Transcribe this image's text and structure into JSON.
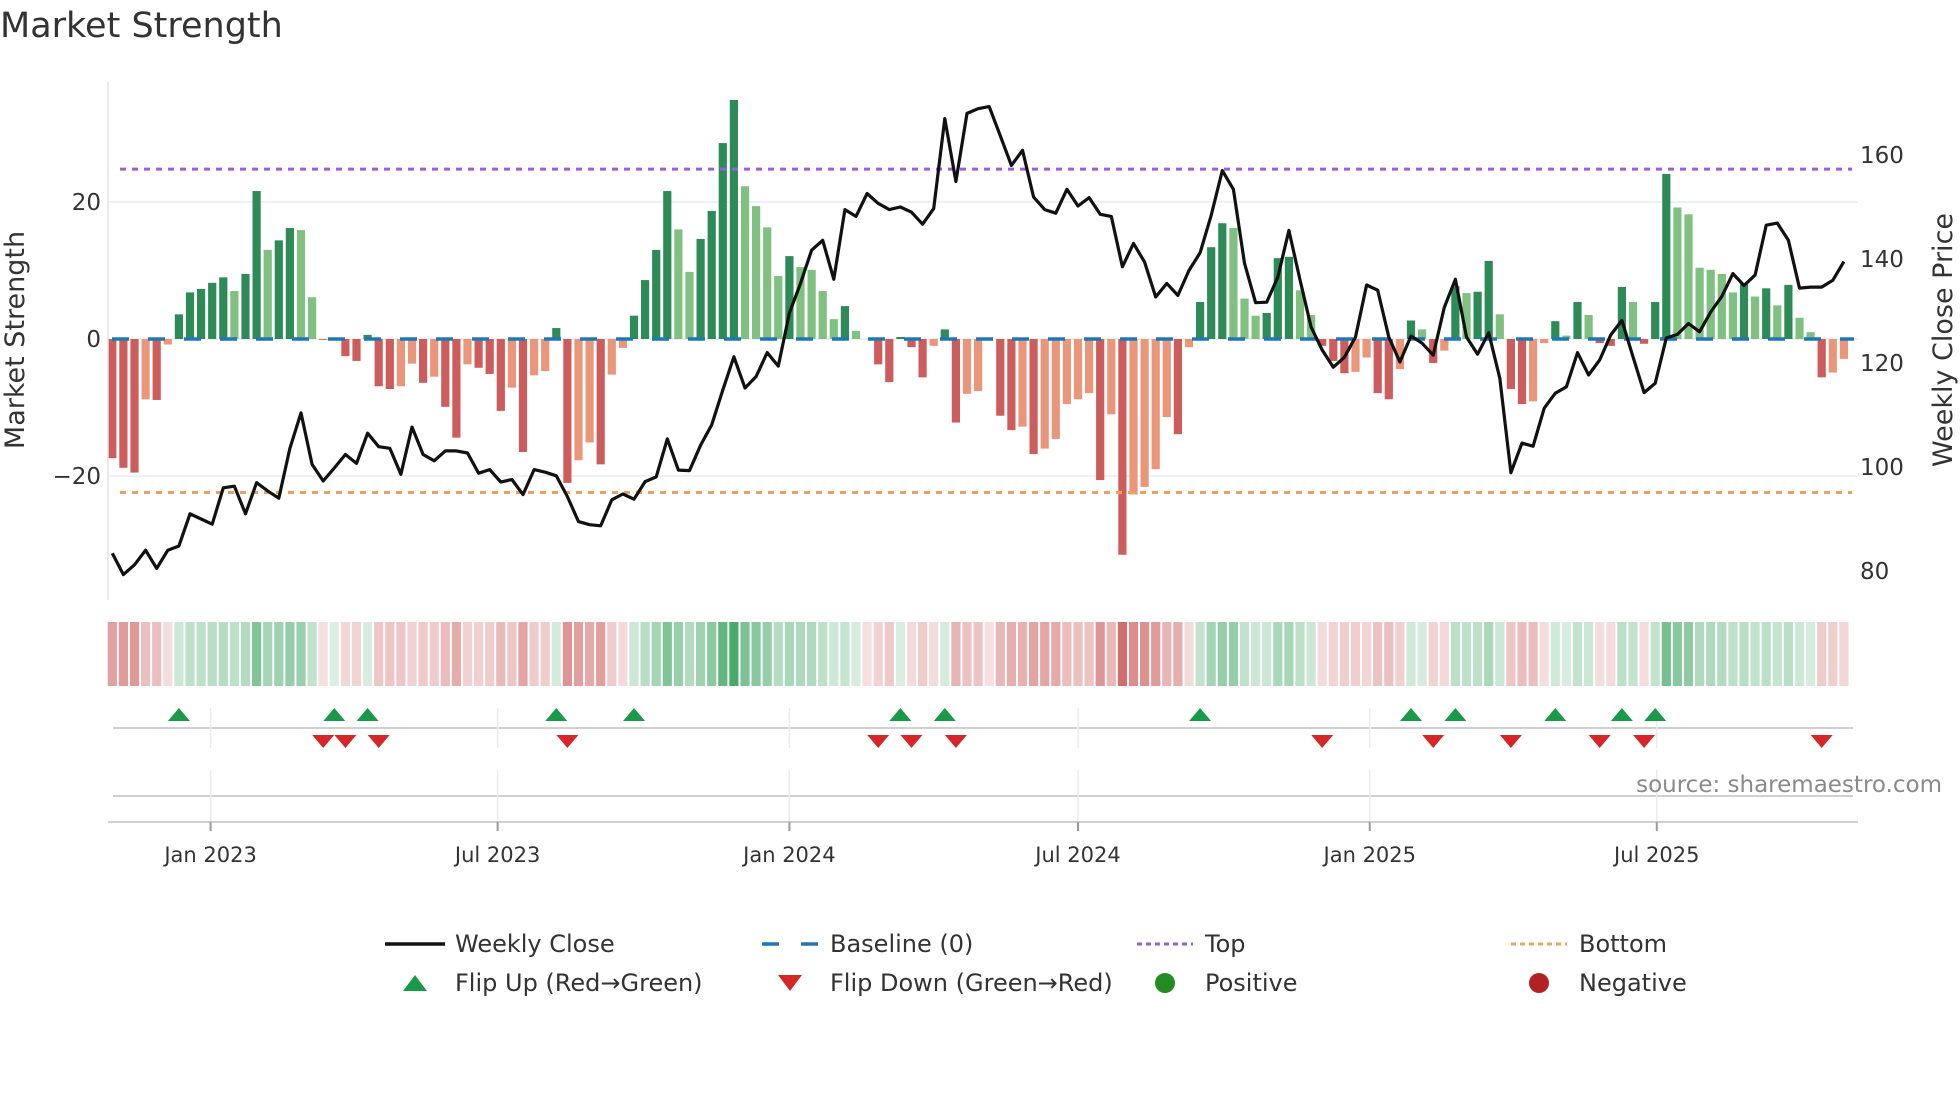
{
  "title": "Market Strength",
  "source": "source: sharemaestro.com",
  "colors": {
    "pos_dark": "#2e8b57",
    "pos_light": "#80c080",
    "neg_dark": "#cd5c5c",
    "neg_light": "#e9967a",
    "heat_pos": "#34a05a",
    "heat_neg": "#c85050",
    "line": "#111111",
    "baseline": "#1f77b4",
    "top": "#9b5fd9",
    "bottom": "#f0a060",
    "flip_up": "#1a9a48",
    "flip_down": "#d62728",
    "positive": "#228b22",
    "negative": "#b22222"
  },
  "chart_data": {
    "type": "bar",
    "title": "Market Strength",
    "ylabel": "Market Strength",
    "y2label": "Weekly Close Price",
    "ylim": [
      -38,
      37.5
    ],
    "y2lim": [
      74.4,
      174
    ],
    "yticks": [
      {
        "value": 20,
        "label": "20"
      },
      {
        "value": 0,
        "label": "0"
      },
      {
        "value": -20,
        "label": "−20"
      }
    ],
    "y2ticks": [
      {
        "value": 160,
        "label": "160"
      },
      {
        "value": 140,
        "label": "140"
      },
      {
        "value": 120,
        "label": "120"
      },
      {
        "value": 100,
        "label": "100"
      },
      {
        "value": 80,
        "label": "80"
      }
    ],
    "xticks": [
      {
        "date": "2023-01-01",
        "label": "Jan 2023"
      },
      {
        "date": "2023-07-01",
        "label": "Jul 2023"
      },
      {
        "date": "2024-01-01",
        "label": "Jan 2024"
      },
      {
        "date": "2024-07-01",
        "label": "Jul 2024"
      },
      {
        "date": "2025-01-01",
        "label": "Jan 2025"
      },
      {
        "date": "2025-07-01",
        "label": "Jul 2025"
      }
    ],
    "start_week": "2022-10-31",
    "interval_days": 7,
    "baseline": 0,
    "top": 24.8,
    "bottom": -22.4,
    "strength": [
      -17.4,
      -18.8,
      -19.5,
      -8.8,
      -8.9,
      -0.8,
      3.6,
      6.8,
      7.3,
      8.2,
      9.0,
      7.0,
      9.5,
      21.6,
      13.0,
      14.4,
      16.2,
      15.9,
      6.1,
      -0.1,
      0.1,
      -2.5,
      -3.2,
      0.6,
      -6.9,
      -7.3,
      -6.9,
      -3.6,
      -6.4,
      -5.5,
      -9.9,
      -14.4,
      -3.7,
      -4.2,
      -5.1,
      -10.5,
      -7.1,
      -16.5,
      -5.3,
      -4.7,
      1.6,
      -21.0,
      -17.7,
      -15.1,
      -18.3,
      -5.2,
      -1.3,
      3.4,
      8.6,
      13.0,
      21.6,
      16.0,
      9.8,
      14.6,
      18.7,
      28.6,
      34.9,
      22.3,
      19.4,
      16.3,
      9.2,
      12.1,
      10.5,
      10.1,
      7.0,
      2.9,
      4.8,
      1.2,
      0,
      -3.7,
      -6.3,
      0.3,
      -1.2,
      -5.6,
      -1.0,
      1.4,
      -12.2,
      -8.0,
      -7.6,
      0,
      -11.2,
      -13.3,
      -12.8,
      -16.8,
      -16.0,
      -14.6,
      -9.5,
      -8.8,
      -7.9,
      -20.6,
      -11.0,
      -31.5,
      -22.7,
      -21.6,
      -19.0,
      -11.4,
      -13.9,
      -1.2,
      5.4,
      13.4,
      16.9,
      16.2,
      5.9,
      3.4,
      3.8,
      11.8,
      12.0,
      7.1,
      3.5,
      -1.0,
      -3.2,
      -5.0,
      -4.8,
      -2.7,
      -7.9,
      -8.8,
      -4.4,
      2.7,
      1.4,
      -3.5,
      -1.7,
      7.7,
      6.7,
      6.9,
      11.4,
      3.6,
      -7.3,
      -9.5,
      -9.1,
      -0.6,
      2.6,
      0.5,
      5.4,
      3.5,
      -0.6,
      -1.0,
      7.6,
      5.4,
      -0.7,
      5.4,
      24.1,
      19.2,
      18.2,
      10.4,
      10.1,
      9.5,
      6.8,
      8.0,
      6.2,
      7.4,
      4.9,
      7.9,
      3.1,
      1.0,
      -5.6,
      -4.9,
      -2.9
    ],
    "weekly_close": [
      83.4,
      79.3,
      81.2,
      84,
      80.5,
      84,
      84.8,
      91,
      90,
      89,
      96,
      96.3,
      91,
      97,
      95.4,
      94,
      103.6,
      110.4,
      100.5,
      97.3,
      99.8,
      102.4,
      100.7,
      106.5,
      103.9,
      103.6,
      98.6,
      107.7,
      102.4,
      101.2,
      103.1,
      103.1,
      102.7,
      98.8,
      99.5,
      97.1,
      97.6,
      94.7,
      99.5,
      99,
      98.3,
      94.3,
      89.5,
      88.9,
      88.7,
      93.7,
      94.8,
      93.8,
      97.2,
      98.1,
      105.4,
      99.4,
      99.3,
      104.2,
      108.1,
      114.8,
      121.2,
      115.2,
      117.4,
      122.0,
      119.4,
      129.6,
      135.3,
      141.7,
      143.6,
      136.1,
      149.5,
      148.2,
      152.6,
      150.7,
      149.5,
      150.0,
      149.0,
      146.7,
      149.7,
      167.0,
      154.9,
      168.0,
      168.9,
      169.3,
      163.7,
      158.0,
      160.9,
      151.9,
      149.5,
      148.8,
      153.4,
      150.2,
      151.8,
      148.6,
      148.2,
      138.5,
      143.0,
      139.4,
      132.7,
      135.3,
      133.0,
      137.8,
      141.2,
      148.4,
      157.0,
      153.4,
      139.2,
      131.6,
      131.7,
      136.5,
      145.5,
      136.0,
      126.9,
      122.5,
      119.2,
      121.1,
      125.0,
      135.0,
      134.0,
      125.0,
      120.2,
      125.2,
      123.8,
      121.5,
      130.7,
      136.1,
      125.0,
      121.7,
      125.8,
      117.1,
      98.9,
      104.6,
      104.0,
      111.3,
      114.2,
      115.4,
      122.0,
      117.7,
      120.6,
      125.4,
      128.2,
      121.2,
      114.3,
      116.1,
      124.8,
      125.5,
      127.6,
      126.0,
      129.8,
      132.8,
      137.2,
      134.9,
      136.9,
      146.5,
      146.9,
      143.6,
      134.4,
      134.6,
      134.6,
      135.9,
      139.5
    ],
    "legend": {
      "weekly_close": "Weekly Close",
      "baseline": "Baseline (0)",
      "top": "Top",
      "bottom": "Bottom",
      "flip_up": "Flip Up (Red→Green)",
      "flip_down": "Flip Down (Green→Red)",
      "positive": "Positive",
      "negative": "Negative"
    },
    "legend_placement": "bottom"
  }
}
